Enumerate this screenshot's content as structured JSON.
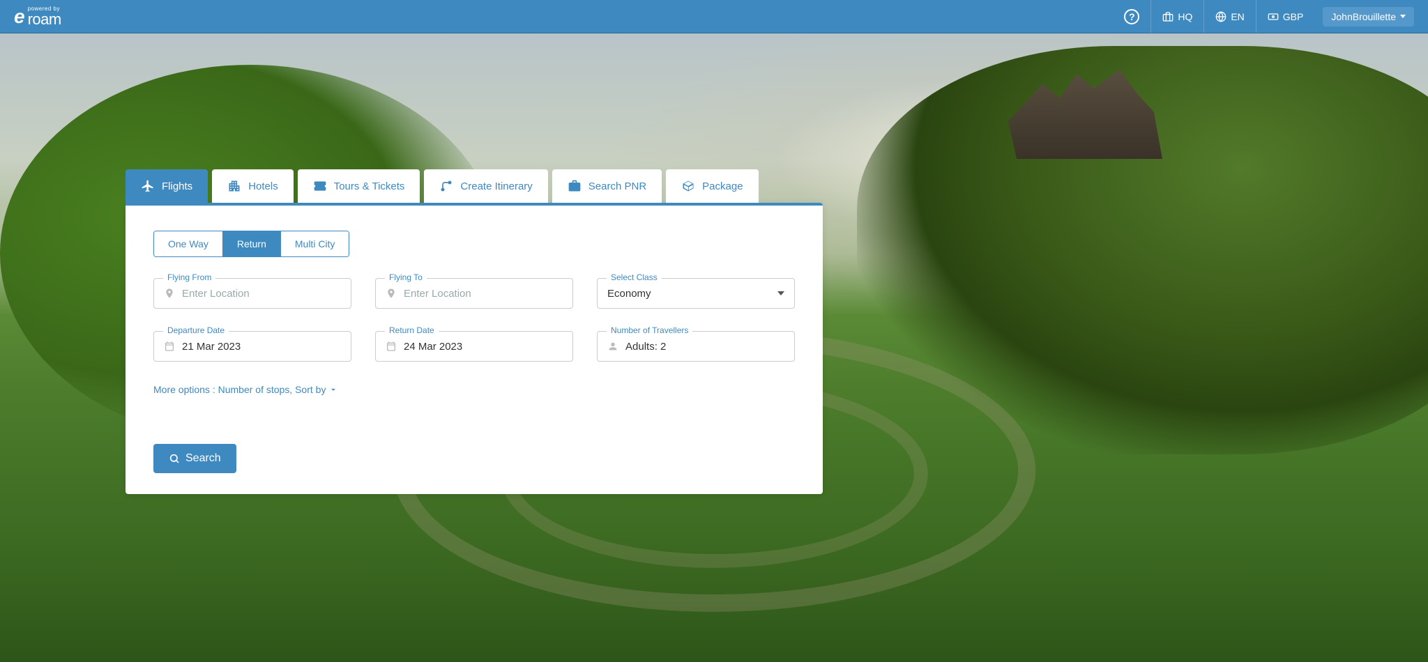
{
  "header": {
    "logo_powered": "powered by",
    "logo_brand": "roam",
    "hq": "HQ",
    "lang": "EN",
    "currency": "GBP",
    "user": "JohnBrouillette"
  },
  "tabs": {
    "flights": "Flights",
    "hotels": "Hotels",
    "tours": "Tours & Tickets",
    "itinerary": "Create Itinerary",
    "pnr": "Search PNR",
    "package": "Package"
  },
  "trip_types": {
    "one_way": "One Way",
    "return": "Return",
    "multi": "Multi City"
  },
  "form": {
    "from_label": "Flying From",
    "from_placeholder": "Enter Location",
    "to_label": "Flying To",
    "to_placeholder": "Enter Location",
    "class_label": "Select Class",
    "class_value": "Economy",
    "dep_label": "Departure Date",
    "dep_value": "21 Mar 2023",
    "ret_label": "Return Date",
    "ret_value": "24 Mar 2023",
    "trav_label": "Number of Travellers",
    "trav_value": "Adults: 2",
    "more_options": "More options : Number of stops, Sort by",
    "search": "Search"
  }
}
